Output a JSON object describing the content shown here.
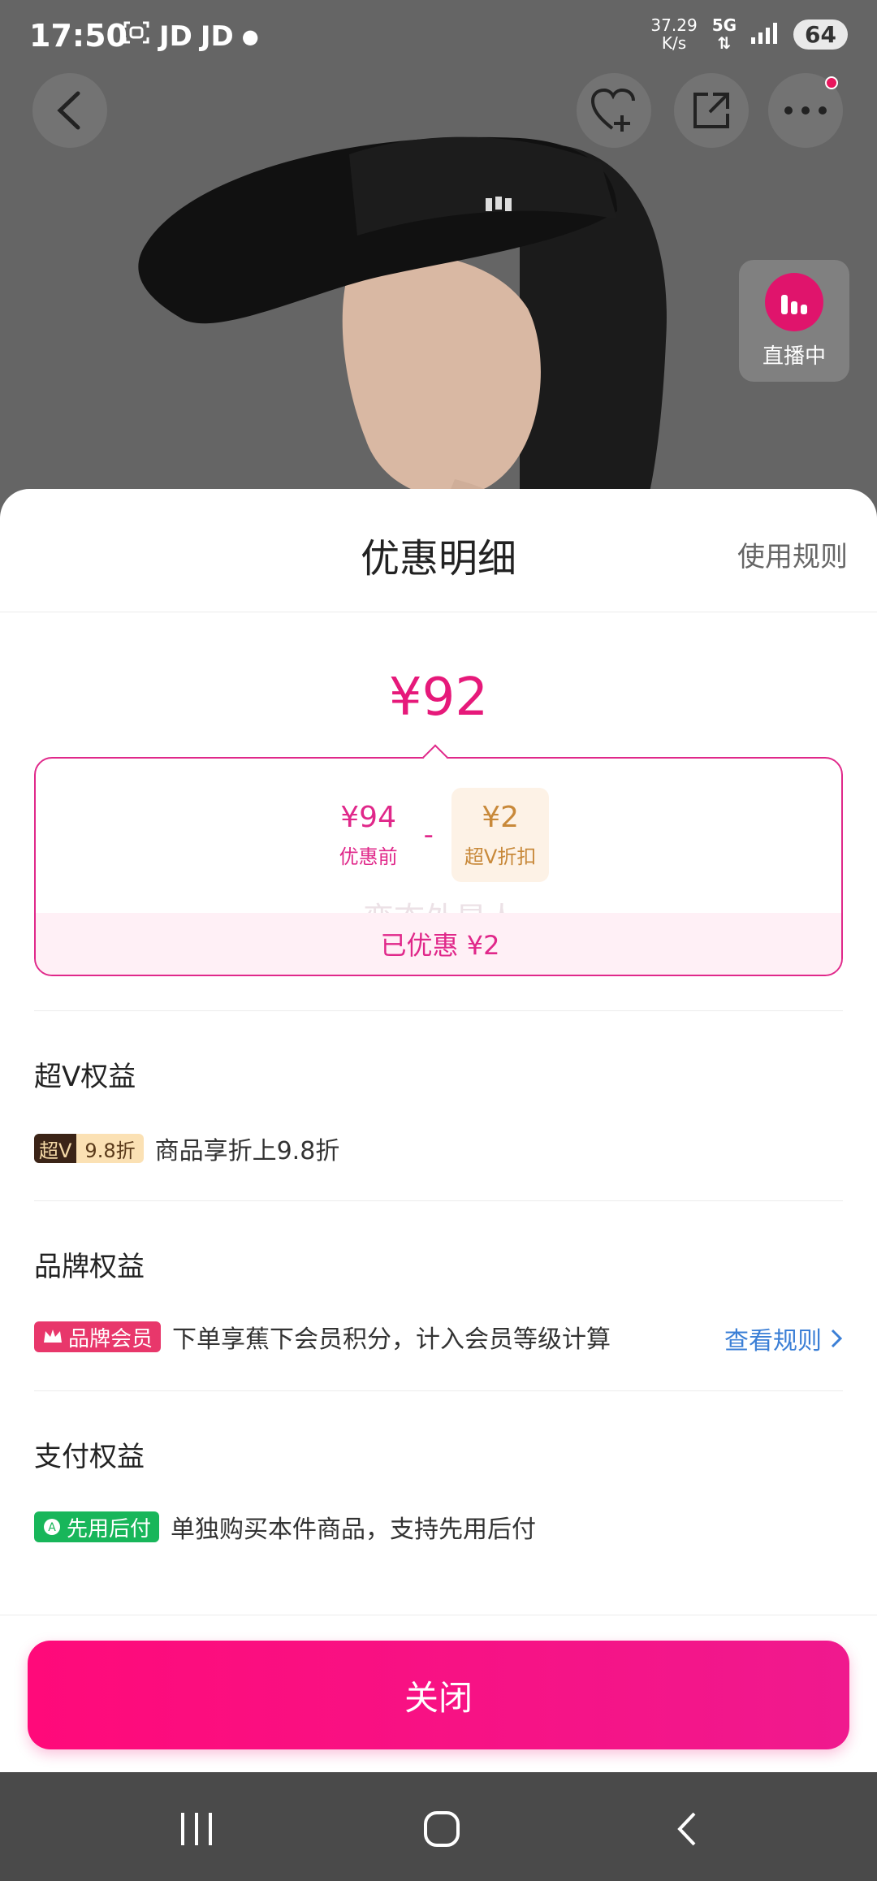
{
  "status": {
    "time": "17:50",
    "apps": [
      "JD",
      "JD"
    ],
    "speed_value": "37.29",
    "speed_unit": "K/s",
    "network": "5G",
    "battery": "64"
  },
  "live": {
    "label": "直播中"
  },
  "sheet": {
    "title": "优惠明细",
    "rules_link": "使用规则",
    "final_price": "¥92",
    "calc": {
      "original_value": "¥94",
      "original_label": "优惠前",
      "minus": "-",
      "discount_value": "¥2",
      "discount_label": "超V折扣",
      "saved": "已优惠 ¥2",
      "watermark": "变态外星人"
    },
    "superv": {
      "title": "超V权益",
      "tag_left": "超V",
      "tag_right": "9.8折",
      "text": "商品享折上9.8折"
    },
    "brand": {
      "title": "品牌权益",
      "tag": "品牌会员",
      "text": "下单享蕉下会员积分，计入会员等级计算",
      "link": "查看规则"
    },
    "pay": {
      "title": "支付权益",
      "tag": "先用后付",
      "text": "单独购买本件商品，支持先用后付"
    },
    "close_label": "关闭"
  },
  "colors": {
    "accent": "#e6197a",
    "brand_tag": "#e8376b",
    "pay_tag": "#18b65a",
    "link": "#3b7fd6"
  }
}
